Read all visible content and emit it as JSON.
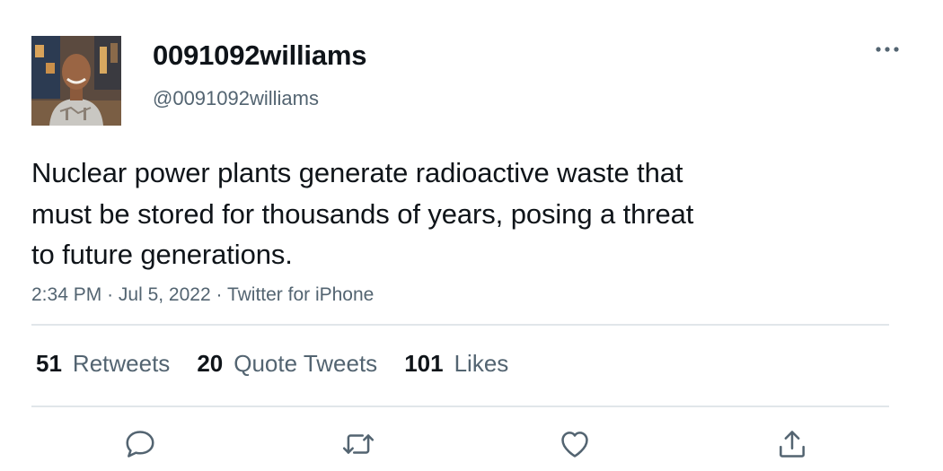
{
  "author": {
    "display_name": "0091092williams",
    "handle": "@0091092williams",
    "avatar_icon": "profile-photo"
  },
  "tweet": {
    "lines": [
      "Nuclear power plants generate radioactive waste that",
      "must be stored for thousands of years, posing a threat",
      "to future generations."
    ],
    "time": "2:34 PM",
    "date": "Jul 5, 2022",
    "source": "Twitter for iPhone",
    "separator": "·"
  },
  "stats": {
    "retweets": {
      "count": "51",
      "label": "Retweets"
    },
    "quotes": {
      "count": "20",
      "label": "Quote Tweets"
    },
    "likes": {
      "count": "101",
      "label": "Likes"
    }
  },
  "actions": {
    "reply": "reply-icon",
    "retweet": "retweet-icon",
    "like": "heart-icon",
    "share": "share-icon"
  },
  "colors": {
    "primary_text": "#0f1419",
    "secondary_text": "#536471",
    "divider": "#e1e6ea"
  }
}
